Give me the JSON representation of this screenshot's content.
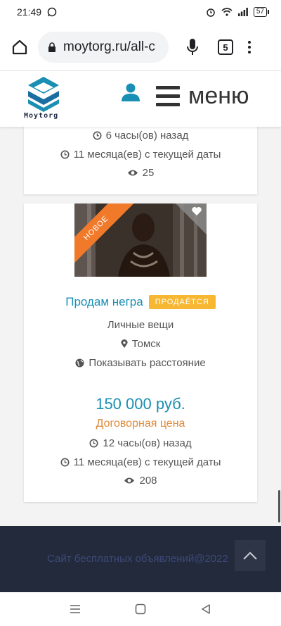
{
  "status_bar": {
    "time": "21:49",
    "battery": "57"
  },
  "browser": {
    "url": "moytorg.ru/all-c",
    "tab_count": "5"
  },
  "header": {
    "logo_text": "Moytorg",
    "menu_label": "меню"
  },
  "listings": [
    {
      "posted": "6 часы(ов) назад",
      "age": "11 месяца(ев) с текущей даты",
      "views": "25"
    },
    {
      "ribbon": "НОВОЕ",
      "title": "Продам негра",
      "status": "ПРОДАЁТСЯ",
      "category": "Личные вещи",
      "city": "Томск",
      "distance_label": "Показывать расстояние",
      "price": "150 000 руб.",
      "price_note": "Договорная цена",
      "posted": "12 часы(ов) назад",
      "age": "11 месяца(ев) с текущей даты",
      "views": "208"
    }
  ],
  "footer": {
    "copyright": "Сайт бесплатных объявлений@2022"
  },
  "colors": {
    "accent": "#1a8fb4",
    "ribbon": "#f07a2a",
    "badge": "#f7b733",
    "price_note": "#e08a3a",
    "footer_bg": "#222a3c"
  }
}
